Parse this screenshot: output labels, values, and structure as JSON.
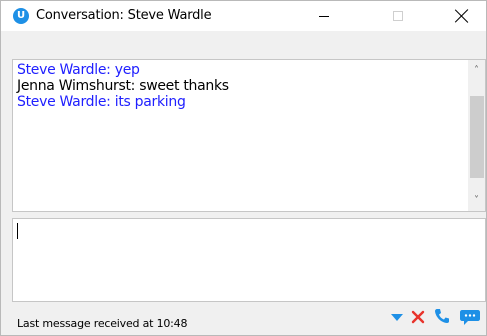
{
  "window": {
    "title": "Conversation: Steve Wardle",
    "app_icon_letter": "U",
    "accent_color": "#1e90e6"
  },
  "messages": [
    {
      "sender": "Steve Wardle",
      "text": "Steve Wardle: yep",
      "color": "#2020ff"
    },
    {
      "sender": "Jenna Wimshurst",
      "text": "Jenna Wimshurst: sweet thanks",
      "color": "#000000"
    },
    {
      "sender": "Steve Wardle",
      "text": "Steve Wardle: its parking",
      "color": "#2020ff"
    }
  ],
  "input": {
    "value": ""
  },
  "status": {
    "text": "Last message received at 10:48"
  },
  "toolbar": {
    "icons": [
      "dropdown-icon",
      "end-conversation-icon",
      "phone-icon",
      "chat-icon"
    ]
  }
}
